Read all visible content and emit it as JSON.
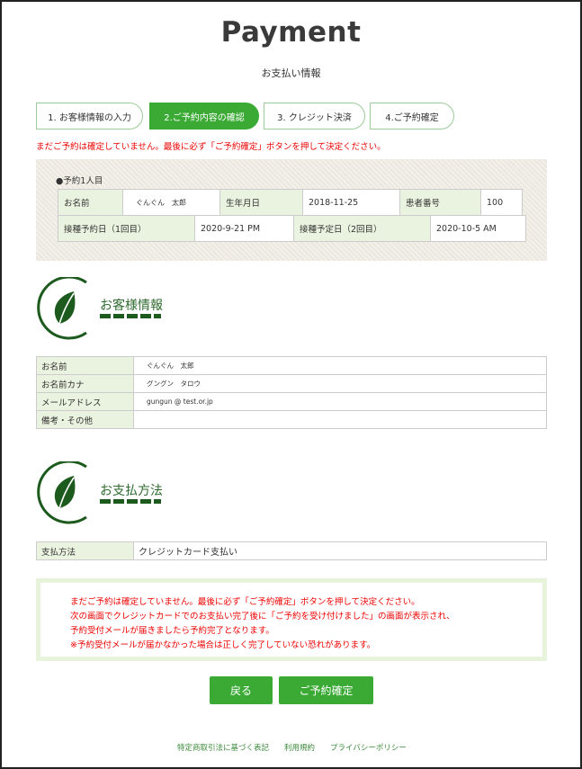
{
  "header": {
    "title": "Payment",
    "subtitle": "お支払い情報"
  },
  "steps": [
    {
      "label": "1. お客様情報の入力",
      "active": false
    },
    {
      "label": "2.ご予約内容の確認",
      "active": true
    },
    {
      "label": "3. クレジット決済",
      "active": false
    },
    {
      "label": "4.ご予約確定",
      "active": false
    }
  ],
  "warning_top": "まだご予約は確定していません。最後に必ず「ご予約確定」ボタンを押して決定ください。",
  "appointment": {
    "label": "●予約1人目",
    "name_label": "お名前",
    "name_value": "ぐんぐん　太郎",
    "birth_label": "生年月日",
    "birth_value": "2018-11-25",
    "patient_label": "患者番号",
    "patient_value": "100",
    "first_label": "接種予約日（1回目）",
    "first_value": "2020-9-21 PM",
    "second_label": "接種予定日（2回目）",
    "second_value": "2020-10-5 AM"
  },
  "customer": {
    "heading": "お客様情報",
    "rows": [
      {
        "label": "お名前",
        "value": "ぐんぐん　太郎"
      },
      {
        "label": "お名前カナ",
        "value": "グングン　タロウ"
      },
      {
        "label": "メールアドレス",
        "value": "gungun @ test.or.jp"
      },
      {
        "label": "備考・その他",
        "value": ""
      }
    ]
  },
  "payment": {
    "heading": "お支払方法",
    "label": "支払方法",
    "value": "クレジットカード支払い"
  },
  "notice": [
    "まだご予約は確定していません。最後に必ず「ご予約確定」ボタンを押して決定ください。",
    "次の画面でクレジットカードでのお支払い完了後に「ご予約を受け付けました」の画面が表示され、",
    "予約受付メールが届きましたら予約完了となります。",
    "※予約受付メールが届かなかった場合は正しく完了していない恐れがあります。"
  ],
  "buttons": {
    "back": "戻る",
    "confirm": "ご予約確定"
  },
  "footer": {
    "links": [
      "特定商取引法に基づく表記",
      "利用規約",
      "プライバシーポリシー"
    ]
  },
  "colors": {
    "accent": "#3aaa35",
    "dark_green": "#1d5a1d",
    "warning": "#ee0000"
  },
  "icons": {
    "section": "leaf-icon"
  }
}
